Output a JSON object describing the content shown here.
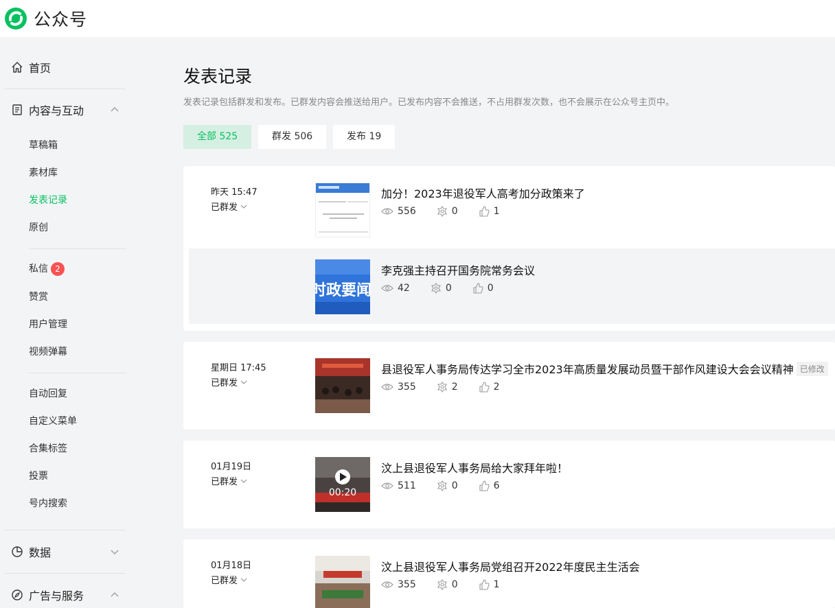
{
  "app": {
    "title": "公众号"
  },
  "sidebar": {
    "home": "首页",
    "content": "内容与互动",
    "content_items": [
      "草稿箱",
      "素材库",
      "发表记录",
      "原创"
    ],
    "interact_items": [
      "私信",
      "赞赏",
      "用户管理",
      "视频弹幕"
    ],
    "message_badge": "2",
    "func_items": [
      "自动回复",
      "自定义菜单",
      "合集标签",
      "投票",
      "号内搜索"
    ],
    "data": "数据",
    "ads": "广告与服务"
  },
  "page": {
    "title": "发表记录",
    "desc": "发表记录包括群发和发布。已群发内容会推送给用户。已发布内容不会推送，不占用群发次数，也不会展示在公众号主页中。"
  },
  "tabs": [
    {
      "label": "全部 525"
    },
    {
      "label": "群发 506"
    },
    {
      "label": "发布 19"
    }
  ],
  "records": [
    {
      "date": "昨天 15:47",
      "status": "已群发",
      "articles": [
        {
          "title": "加分！2023年退役军人高考加分政策来了",
          "views": "556",
          "shares": "0",
          "likes": "1"
        },
        {
          "title": "李克强主持召开国务院常务会议",
          "views": "42",
          "shares": "0",
          "likes": "0",
          "thumb_text": "时政要闻"
        }
      ]
    },
    {
      "date": "星期日 17:45",
      "status": "已群发",
      "articles": [
        {
          "title": "县退役军人事务局传达学习全市2023年高质量发展动员暨干部作风建设大会会议精神",
          "modified": "已修改",
          "views": "355",
          "shares": "2",
          "likes": "2"
        }
      ]
    },
    {
      "date": "01月19日",
      "status": "已群发",
      "articles": [
        {
          "title": "汶上县退役军人事务局给大家拜年啦！",
          "views": "511",
          "shares": "0",
          "likes": "6",
          "duration": "00:20"
        }
      ]
    },
    {
      "date": "01月18日",
      "status": "已群发",
      "articles": [
        {
          "title": "汶上县退役军人事务局党组召开2022年度民主生活会",
          "views": "355",
          "shares": "0",
          "likes": "1"
        }
      ]
    }
  ],
  "colors": {
    "accent": "#07c160",
    "badge": "#fa5151"
  }
}
